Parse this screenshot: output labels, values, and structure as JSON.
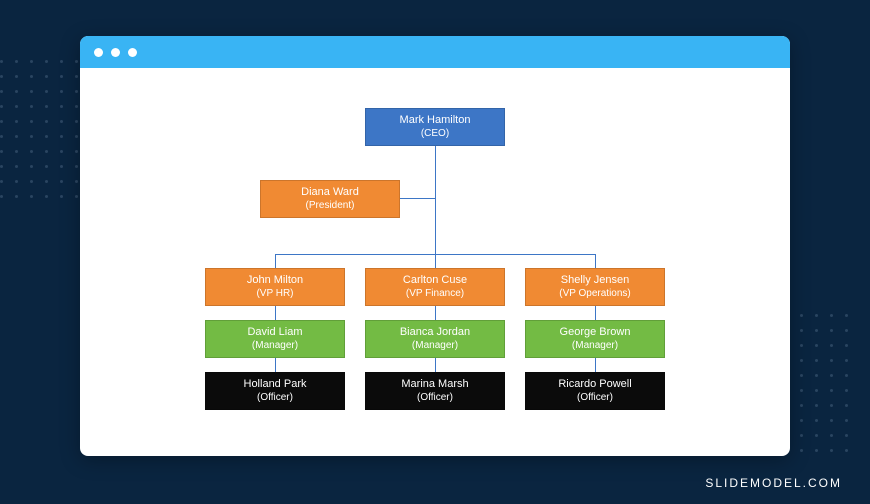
{
  "watermark": "SLIDEMODEL.COM",
  "org": {
    "ceo": {
      "name": "Mark Hamilton",
      "role": "(CEO)"
    },
    "president": {
      "name": "Diana Ward",
      "role": "(President)"
    },
    "vp1": {
      "name": "John Milton",
      "role": "(VP HR)"
    },
    "vp2": {
      "name": "Carlton Cuse",
      "role": "(VP Finance)"
    },
    "vp3": {
      "name": "Shelly Jensen",
      "role": "(VP Operations)"
    },
    "mgr1": {
      "name": "David Liam",
      "role": "(Manager)"
    },
    "mgr2": {
      "name": "Bianca Jordan",
      "role": "(Manager)"
    },
    "mgr3": {
      "name": "George Brown",
      "role": "(Manager)"
    },
    "off1": {
      "name": "Holland Park",
      "role": "(Officer)"
    },
    "off2": {
      "name": "Marina Marsh",
      "role": "(Officer)"
    },
    "off3": {
      "name": "Ricardo Powell",
      "role": "(Officer)"
    }
  }
}
